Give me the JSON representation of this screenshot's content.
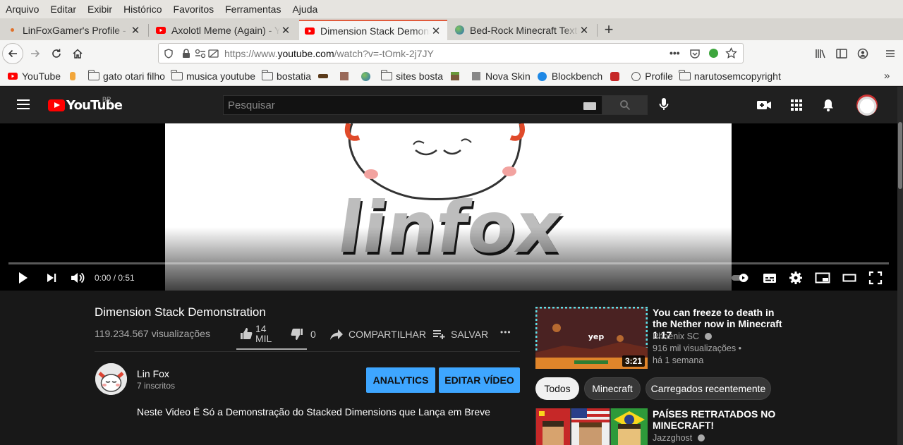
{
  "menu": [
    "Arquivo",
    "Editar",
    "Exibir",
    "Histórico",
    "Favoritos",
    "Ferramentas",
    "Ajuda"
  ],
  "tabs": [
    {
      "title": "LinFoxGamer's Profile - N",
      "active": false
    },
    {
      "title": "Axolotl Meme (Again) - Yo",
      "active": false
    },
    {
      "title": "Dimension Stack Demonst",
      "active": true
    },
    {
      "title": "Bed-Rock Minecraft Textu",
      "active": false
    }
  ],
  "url": {
    "prefix": "https://www.",
    "domain": "youtube.com",
    "path": "/watch?v=-tOmk-2j7JY"
  },
  "bookmarks": [
    "YouTube",
    "",
    "gato otari filho",
    "musica youtube",
    "bostatia",
    "",
    "",
    "",
    "sites bosta",
    "",
    "Nova Skin",
    "Blockbench",
    "",
    "Profile",
    "narutosemcopyright"
  ],
  "yt": {
    "logo": "YouTube",
    "region": "BR",
    "search_placeholder": "Pesquisar"
  },
  "player": {
    "time": "0:00 / 0:51",
    "video_text": "linfox"
  },
  "video": {
    "title": "Dimension Stack Demonstration",
    "views": "119.234.567 visualizações",
    "likes_top": "14",
    "likes_bottom": "MIL",
    "dislikes": "0",
    "share": "COMPARTILHAR",
    "save": "SALVAR",
    "more": "•••"
  },
  "channel": {
    "name": "Lin Fox",
    "subs": "7 inscritos",
    "analytics": "ANALYTICS",
    "edit": "EDITAR VÍDEO",
    "description": "Neste Video É Só a Demonstração do Stacked Dimensions que Lança em Breve"
  },
  "sidebar": {
    "top": {
      "title": "You can freeze to death in the Nether now in Minecraft 1.17",
      "channel": "Phoenix SC",
      "views": "916 mil visualizações •",
      "age": "há 1 semana",
      "duration": "3:21",
      "thumb_text": "yep"
    },
    "chips": [
      "Todos",
      "Minecraft",
      "Carregados recentemente"
    ],
    "second": {
      "title": "PAÍSES RETRATADOS NO MINECRAFT!",
      "channel": "Jazzghost"
    }
  }
}
